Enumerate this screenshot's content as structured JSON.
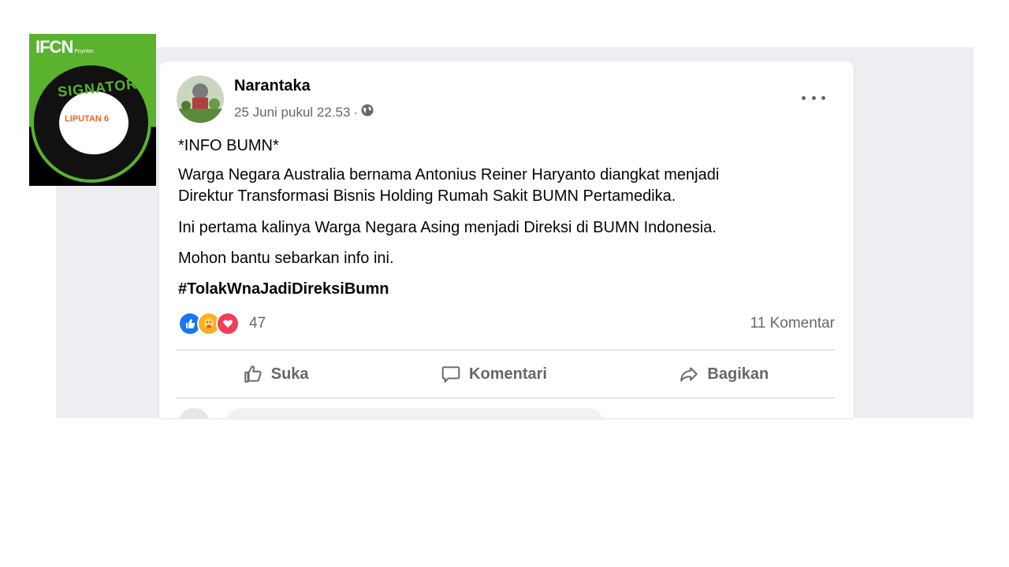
{
  "post": {
    "author": "Narantaka",
    "timestamp": "25 Juni pukul 22.53",
    "separator": "·",
    "privacy_icon": "globe-icon",
    "title_line": "*INFO BUMN*",
    "paragraph1_line1": "Warga Negara Australia bernama Antonius Reiner Haryanto diangkat menjadi",
    "paragraph1_line2": "Direktur Transformasi Bisnis Holding Rumah Sakit BUMN Pertamedika.",
    "paragraph2": "Ini pertama kalinya Warga Negara Asing menjadi Direksi di BUMN Indonesia.",
    "paragraph3": "Mohon bantu sebarkan info ini.",
    "hashtag": "#TolakWnaJadiDireksiBumn",
    "reaction_count": "47",
    "reaction_icons": [
      "like-icon",
      "care-icon",
      "love-icon"
    ],
    "comment_count": "11 Komentar"
  },
  "actions": {
    "like_label": "Suka",
    "comment_label": "Komentari",
    "share_label": "Bagikan"
  },
  "badge": {
    "logo_text": "IFCN",
    "logo_sub": "Poynter.",
    "signatory": "SIGNATORY",
    "org": "LIPUTAN 6"
  },
  "colors": {
    "badge_green": "#5ab22f",
    "facebook_blue": "#1877f2",
    "love_red": "#f33e58",
    "care_yellow": "#f7b125",
    "secondary_text": "#65676b"
  }
}
